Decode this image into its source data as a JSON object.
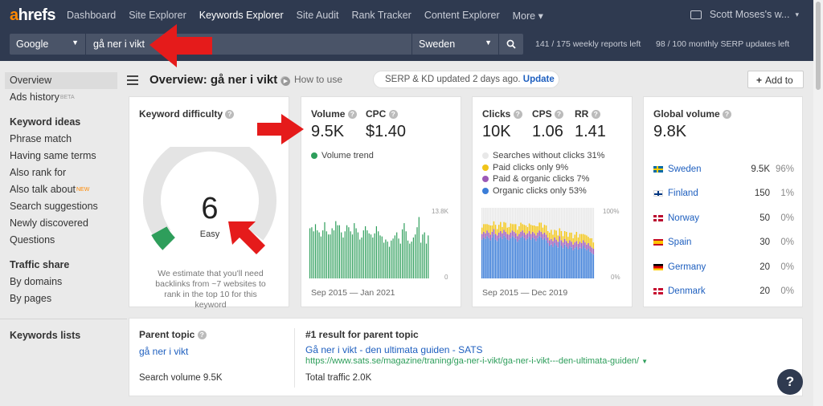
{
  "brand": {
    "logo_a": "a",
    "logo_rest": "hrefs"
  },
  "nav": {
    "items": [
      "Dashboard",
      "Site Explorer",
      "Keywords Explorer",
      "Site Audit",
      "Rank Tracker",
      "Content Explorer",
      "More"
    ],
    "active": "Keywords Explorer",
    "user": "Scott Moses's w..."
  },
  "search": {
    "engine": "Google",
    "query": "gå ner i vikt",
    "country": "Sweden",
    "weekly_reports": "141 / 175 weekly reports left",
    "serp_updates": "98 / 100 monthly SERP updates left"
  },
  "sidebar": {
    "top": [
      {
        "label": "Overview",
        "selected": true,
        "sup": ""
      },
      {
        "label": "Ads history",
        "selected": false,
        "sup": "BETA"
      }
    ],
    "keyword_ideas_heading": "Keyword ideas",
    "keyword_ideas": [
      {
        "label": "Phrase match",
        "sup": ""
      },
      {
        "label": "Having same terms",
        "sup": ""
      },
      {
        "label": "Also rank for",
        "sup": ""
      },
      {
        "label": "Also talk about",
        "sup": "NEW"
      },
      {
        "label": "Search suggestions",
        "sup": ""
      },
      {
        "label": "Newly discovered",
        "sup": ""
      },
      {
        "label": "Questions",
        "sup": ""
      }
    ],
    "traffic_share_heading": "Traffic share",
    "traffic_share": [
      "By domains",
      "By pages"
    ],
    "keywords_lists": "Keywords lists"
  },
  "header": {
    "title": "Overview: gå ner i vikt",
    "how_to_use": "How to use",
    "updated_text": "SERP & KD updated 2 days ago.",
    "update_link": "Update",
    "add_to": "Add to"
  },
  "kd": {
    "title": "Keyword difficulty",
    "value": "6",
    "label": "Easy",
    "score": 6,
    "note": "We estimate that you'll need backlinks from ~7 websites to rank in the top 10 for this keyword",
    "accent": "#2e9e5b"
  },
  "volume": {
    "volume_label": "Volume",
    "volume_value": "9.5K",
    "cpc_label": "CPC",
    "cpc_value": "$1.40",
    "trend_legend": "Volume trend",
    "ymax": "13.8K",
    "ymin": "0",
    "dates": "Sep 2015 — Jan 2021",
    "bars": [
      9.8,
      10.0,
      9.2,
      10.6,
      9.4,
      9.0,
      8.2,
      9.4,
      11.0,
      9.2,
      8.6,
      8.6,
      9.8,
      9.4,
      11.2,
      10.4,
      10.4,
      9.0,
      8.0,
      9.2,
      10.4,
      10.0,
      9.2,
      8.6,
      10.8,
      9.8,
      9.0,
      7.6,
      8.0,
      9.4,
      10.2,
      9.4,
      8.8,
      8.6,
      8.0,
      8.8,
      10.2,
      9.2,
      8.4,
      8.2,
      7.0,
      7.6,
      7.2,
      6.2,
      7.4,
      7.8,
      8.4,
      9.0,
      7.8,
      6.8,
      9.6,
      10.8,
      9.2,
      7.4,
      6.8,
      7.2,
      8.0,
      8.6,
      10.0,
      12.0,
      7.0,
      8.6,
      9.0,
      6.8,
      8.4
    ],
    "color": "#2e9e5b"
  },
  "clicks": {
    "clicks_label": "Clicks",
    "clicks_value": "10K",
    "cps_label": "CPS",
    "cps_value": "1.06",
    "rr_label": "RR",
    "rr_value": "1.41",
    "legend": [
      {
        "label": "Searches without clicks 31%",
        "color": "#e8e8e8"
      },
      {
        "label": "Paid clicks only 9%",
        "color": "#f0c419"
      },
      {
        "label": "Paid & organic clicks 7%",
        "color": "#9b59b6"
      },
      {
        "label": "Organic clicks only 53%",
        "color": "#3b7dd8"
      }
    ],
    "ymax": "100%",
    "ymin": "0%",
    "dates": "Sep 2015 — Dec 2019",
    "organic_share": [
      0.55,
      0.58,
      0.56,
      0.6,
      0.57,
      0.54,
      0.58,
      0.62,
      0.55,
      0.53,
      0.57,
      0.59,
      0.56,
      0.61,
      0.58,
      0.55,
      0.54,
      0.57,
      0.6,
      0.58,
      0.56,
      0.52,
      0.55,
      0.58,
      0.6,
      0.57,
      0.54,
      0.56,
      0.59,
      0.55,
      0.58,
      0.56,
      0.53,
      0.57,
      0.6,
      0.58,
      0.55,
      0.57,
      0.54,
      0.5,
      0.46,
      0.48,
      0.45,
      0.5,
      0.47,
      0.44,
      0.52,
      0.46,
      0.43,
      0.48,
      0.45,
      0.42,
      0.46,
      0.44,
      0.4,
      0.43,
      0.45,
      0.41,
      0.44,
      0.42,
      0.46,
      0.43,
      0.4,
      0.42,
      0.38,
      0.36,
      0.34
    ]
  },
  "global": {
    "title": "Global volume",
    "value": "9.8K",
    "rows": [
      {
        "country": "Sweden",
        "volume": "9.5K",
        "pct": "96%",
        "flag": "se"
      },
      {
        "country": "Finland",
        "volume": "150",
        "pct": "1%",
        "flag": "fi"
      },
      {
        "country": "Norway",
        "volume": "50",
        "pct": "0%",
        "flag": "no"
      },
      {
        "country": "Spain",
        "volume": "30",
        "pct": "0%",
        "flag": "es"
      },
      {
        "country": "Germany",
        "volume": "20",
        "pct": "0%",
        "flag": "de"
      },
      {
        "country": "Denmark",
        "volume": "20",
        "pct": "0%",
        "flag": "dk"
      }
    ]
  },
  "parent": {
    "title": "Parent topic",
    "topic": "gå ner i vikt",
    "search_volume": "Search volume 9.5K",
    "first_result_title": "#1 result for parent topic",
    "result_title": "Gå ner i vikt - den ultimata guiden - SATS",
    "result_url": "https://www.sats.se/magazine/traning/ga-ner-i-vikt/ga-ner-i-vikt---den-ultimata-guiden/",
    "total_traffic": "Total traffic 2.0K"
  },
  "help": "?"
}
